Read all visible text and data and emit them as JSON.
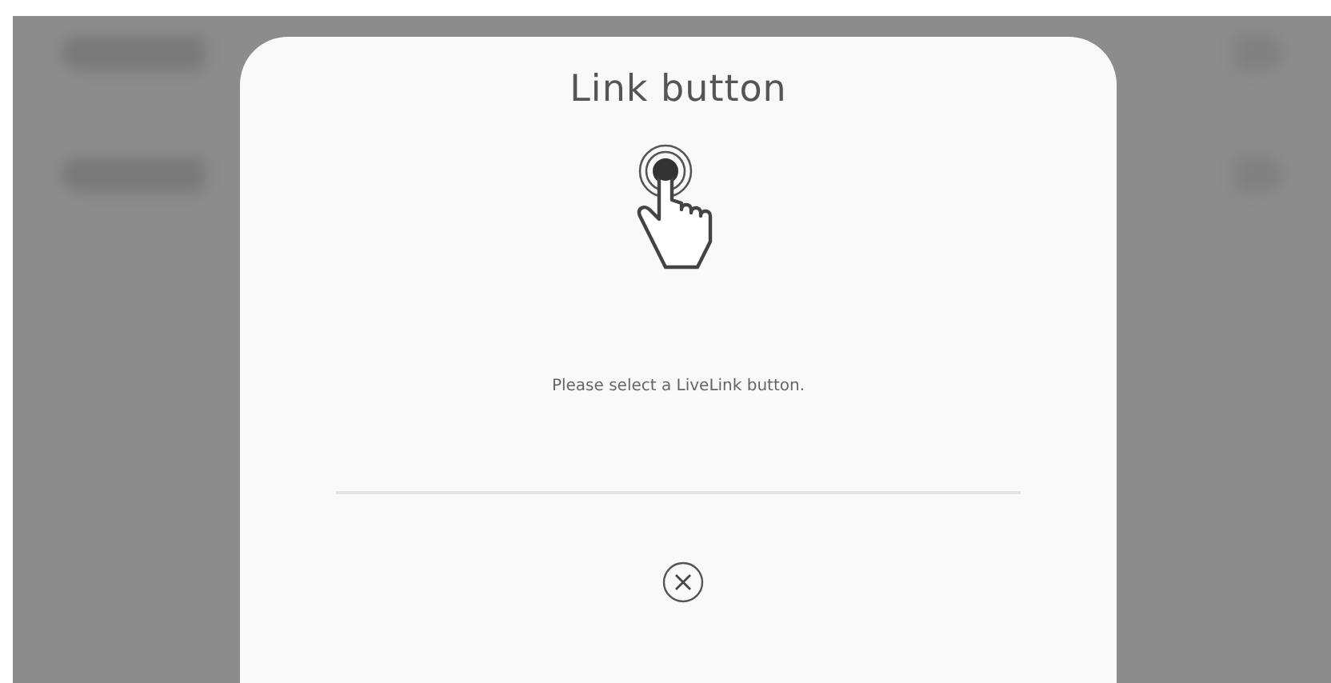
{
  "dialog": {
    "title": "Link button",
    "message": "Please select a LiveLink button."
  }
}
